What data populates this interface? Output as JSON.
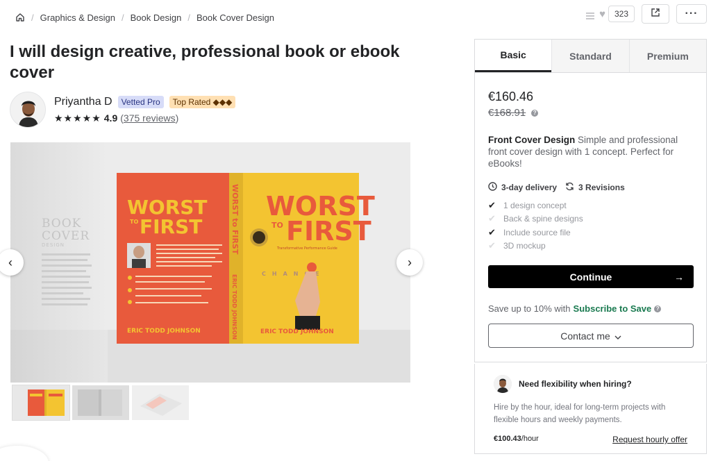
{
  "breadcrumb": {
    "items": [
      "Graphics & Design",
      "Book Design",
      "Book Cover Design"
    ]
  },
  "actions": {
    "likes_count": "323"
  },
  "gig": {
    "title": "I will design creative, professional book or ebook cover"
  },
  "seller": {
    "name": "Priyantha D",
    "badge_vetted": "Vetted Pro",
    "badge_top": "Top Rated ◆◆◆",
    "stars": "★★★★★",
    "rating": "4.9",
    "reviews": "375 reviews"
  },
  "gallery": {
    "cover_left": {
      "title_line1": "WORST",
      "title_to": "TO",
      "title_line2": "FIRST",
      "author": "ERIC TODD JOHNSON",
      "side_text_1": "BOOK",
      "side_text_2": "COVER",
      "side_text_3": "DESIGN"
    },
    "spine": {
      "title": "WORST to FIRST",
      "author": "ERIC TODD JOHNSON"
    },
    "cover_front": {
      "title_line1": "WORST",
      "title_to": "TO",
      "title_line2": "FIRST",
      "subtitle": "Transformative Performance Guide",
      "change": "CHANGE",
      "author": "ERIC TODD JOHNSON"
    }
  },
  "package": {
    "tabs": [
      "Basic",
      "Standard",
      "Premium"
    ],
    "active_tab": "Basic",
    "price": "€160.46",
    "old_price": "€168.91",
    "desc_title": "Front Cover Design",
    "desc_text": " Simple and professional front cover design with 1 concept. Perfect for eBooks!",
    "delivery": "3-day delivery",
    "revisions": "3 Revisions",
    "features": [
      {
        "label": "1 design concept",
        "included": true
      },
      {
        "label": "Back & spine designs",
        "included": false
      },
      {
        "label": "Include source file",
        "included": true
      },
      {
        "label": "3D mockup",
        "included": false
      }
    ],
    "continue_label": "Continue",
    "save_prefix": "Save up to 10% with ",
    "save_link": "Subscribe to Save",
    "contact_label": "Contact me"
  },
  "hourly": {
    "heading": "Need flexibility when hiring?",
    "description": "Hire by the hour, ideal for long-term projects with flexible hours and weekly payments.",
    "rate_value": "€100.43",
    "rate_unit": "/hour",
    "request_label": "Request hourly offer"
  },
  "colors": {
    "accent_green": "#1a7a50",
    "cover_red": "#e85a3c",
    "cover_yellow": "#f3c431",
    "button_black": "#000000"
  }
}
